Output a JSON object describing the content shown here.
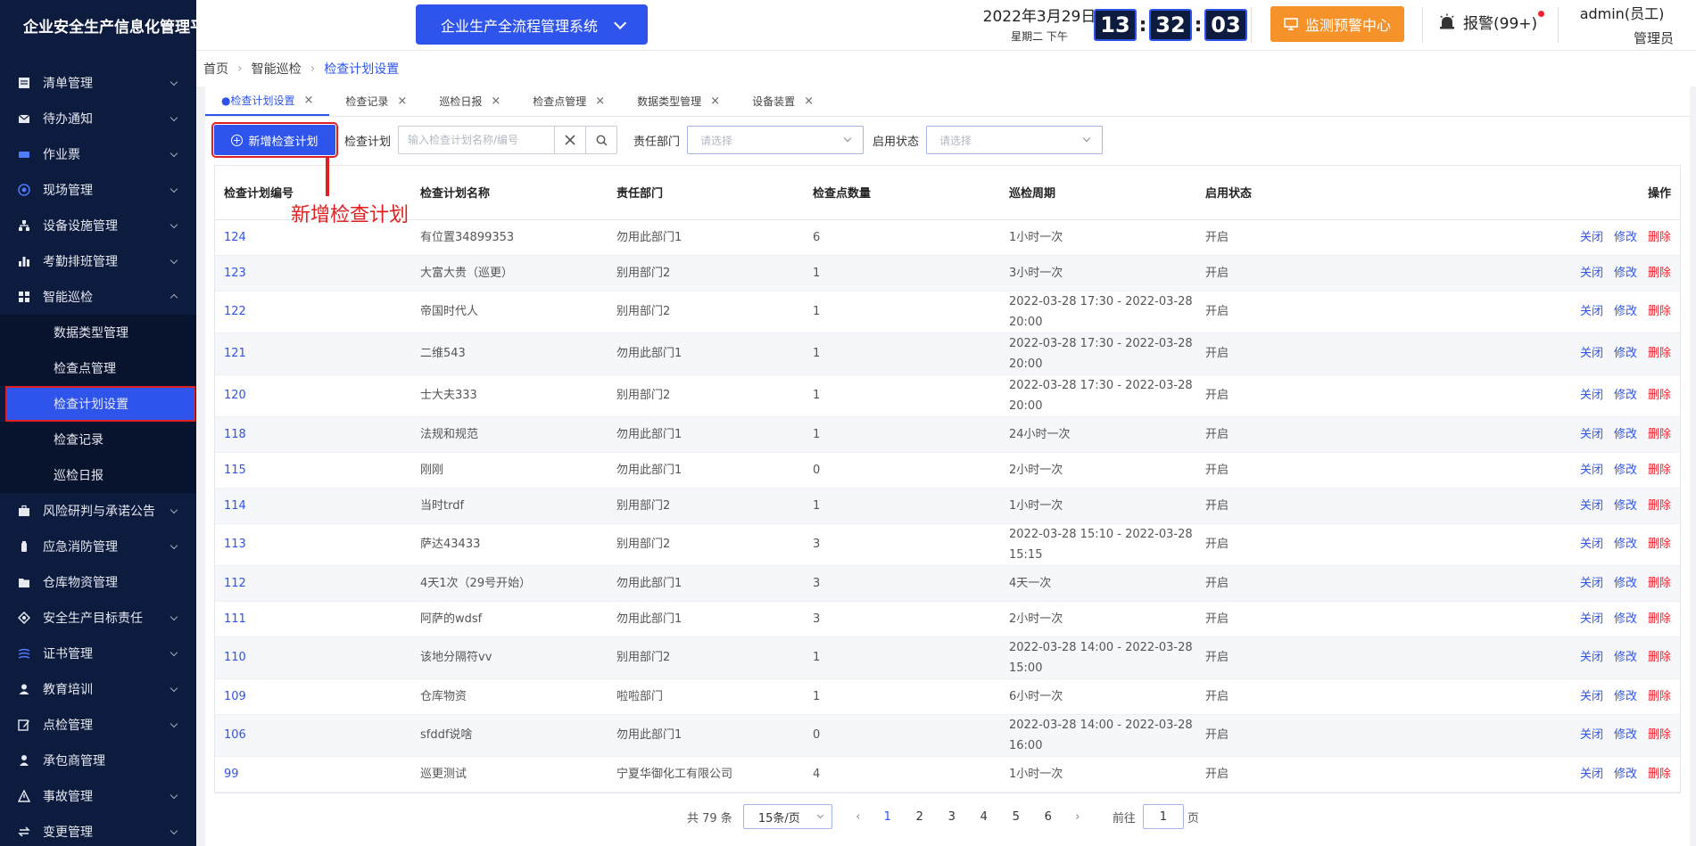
{
  "header": {
    "app_title": "企业安全生产信息化管理平台",
    "system_select": "企业生产全流程管理系统",
    "date": "2022年3月29日",
    "weekday": "星期二 下午",
    "clock": {
      "h": "13",
      "m": "32",
      "s": "03"
    },
    "monitor_label": "监测预警中心",
    "alarm_label": "报警(99+)",
    "user_name": "admin(员工)",
    "user_role": "管理员"
  },
  "sidebar": {
    "items": [
      {
        "label": "清单管理",
        "icon": "list-icon"
      },
      {
        "label": "待办通知",
        "icon": "mail-icon"
      },
      {
        "label": "作业票",
        "icon": "ticket-icon"
      },
      {
        "label": "现场管理",
        "icon": "site-icon"
      },
      {
        "label": "设备设施管理",
        "icon": "device-icon"
      },
      {
        "label": "考勤排班管理",
        "icon": "chart-icon"
      },
      {
        "label": "智能巡检",
        "icon": "grid-icon"
      }
    ],
    "sub_items": [
      "数据类型管理",
      "检查点管理",
      "检查计划设置",
      "检查记录",
      "巡检日报"
    ],
    "items_after": [
      {
        "label": "风险研判与承诺公告",
        "icon": "briefcase-icon"
      },
      {
        "label": "应急消防管理",
        "icon": "fire-icon"
      },
      {
        "label": "仓库物资管理",
        "icon": "folder-icon"
      },
      {
        "label": "安全生产目标责任",
        "icon": "target-icon"
      },
      {
        "label": "证书管理",
        "icon": "certificate-icon"
      },
      {
        "label": "教育培训",
        "icon": "user-icon"
      },
      {
        "label": "点检管理",
        "icon": "edit-icon"
      },
      {
        "label": "承包商管理",
        "icon": "contractor-icon"
      },
      {
        "label": "事故管理",
        "icon": "warning-icon"
      },
      {
        "label": "变更管理",
        "icon": "change-icon"
      }
    ]
  },
  "breadcrumb": [
    "首页",
    "智能巡检",
    "检查计划设置"
  ],
  "tabs": [
    "●检查计划设置",
    "检查记录",
    "巡检日报",
    "检查点管理",
    "数据类型管理",
    "设备装置"
  ],
  "toolbar": {
    "add_label": "新增检查计划",
    "plan_label": "检查计划",
    "plan_placeholder": "输入检查计划名称/编号",
    "dept_label": "责任部门",
    "dept_placeholder": "请选择",
    "status_label": "启用状态",
    "status_placeholder": "请选择"
  },
  "annotation": "新增检查计划",
  "table": {
    "headers": [
      "检查计划编号",
      "检查计划名称",
      "责任部门",
      "检查点数量",
      "巡检周期",
      "启用状态",
      "操作"
    ],
    "op_labels": [
      "关闭",
      "修改",
      "删除"
    ],
    "rows": [
      {
        "id": "124",
        "name": "有位置34899353",
        "dept": "勿用此部门1",
        "count": "6",
        "cycle": "1小时一次",
        "status": "开启"
      },
      {
        "id": "123",
        "name": "大富大贵（巡更）",
        "dept": "别用部门2",
        "count": "1",
        "cycle": "3小时一次",
        "status": "开启"
      },
      {
        "id": "122",
        "name": "帝国时代人",
        "dept": "别用部门2",
        "count": "1",
        "cycle": "2022-03-28 17:30 - 2022-03-28 20:00",
        "status": "开启"
      },
      {
        "id": "121",
        "name": "二维543",
        "dept": "勿用此部门1",
        "count": "1",
        "cycle": "2022-03-28 17:30 - 2022-03-28 20:00",
        "status": "开启"
      },
      {
        "id": "120",
        "name": "士大夫333",
        "dept": "别用部门2",
        "count": "1",
        "cycle": "2022-03-28 17:30 - 2022-03-28 20:00",
        "status": "开启"
      },
      {
        "id": "118",
        "name": "法规和规范",
        "dept": "勿用此部门1",
        "count": "1",
        "cycle": "24小时一次",
        "status": "开启"
      },
      {
        "id": "115",
        "name": "刚刚",
        "dept": "勿用此部门1",
        "count": "0",
        "cycle": "2小时一次",
        "status": "开启"
      },
      {
        "id": "114",
        "name": "当时trdf",
        "dept": "别用部门2",
        "count": "1",
        "cycle": "1小时一次",
        "status": "开启"
      },
      {
        "id": "113",
        "name": "萨达43433",
        "dept": "别用部门2",
        "count": "3",
        "cycle": "2022-03-28 15:10 - 2022-03-28 15:15",
        "status": "开启"
      },
      {
        "id": "112",
        "name": "4天1次（29号开始）",
        "dept": "勿用此部门1",
        "count": "3",
        "cycle": "4天一次",
        "status": "开启"
      },
      {
        "id": "111",
        "name": "阿萨的wdsf",
        "dept": "勿用此部门1",
        "count": "3",
        "cycle": "2小时一次",
        "status": "开启"
      },
      {
        "id": "110",
        "name": "该地分隔符vv",
        "dept": "别用部门2",
        "count": "1",
        "cycle": "2022-03-28 14:00 - 2022-03-28 15:00",
        "status": "开启"
      },
      {
        "id": "109",
        "name": "仓库物资",
        "dept": "啦啦部门",
        "count": "1",
        "cycle": "6小时一次",
        "status": "开启"
      },
      {
        "id": "106",
        "name": "sfddf说啥",
        "dept": "勿用此部门1",
        "count": "0",
        "cycle": "2022-03-28 14:00 - 2022-03-28 16:00",
        "status": "开启"
      },
      {
        "id": "99",
        "name": "巡更测试",
        "dept": "宁夏华御化工有限公司",
        "count": "4",
        "cycle": "1小时一次",
        "status": "开启"
      }
    ]
  },
  "pager": {
    "total": "共 79 条",
    "size": "15条/页",
    "pages": [
      "1",
      "2",
      "3",
      "4",
      "5",
      "6"
    ],
    "current": "1",
    "goto_label": "前往",
    "goto_value": "1",
    "page_suffix": "页"
  }
}
